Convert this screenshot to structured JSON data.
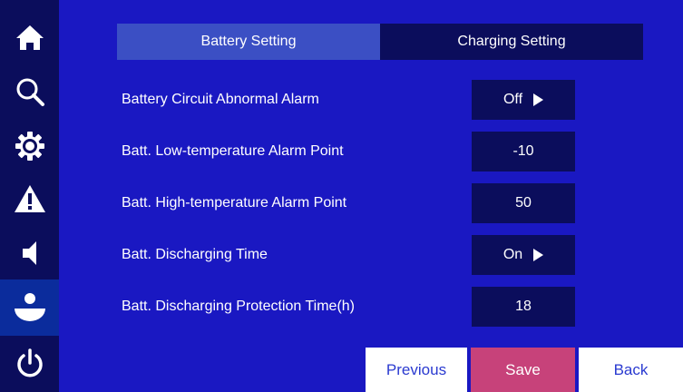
{
  "colors": {
    "background": "#1a18c2",
    "sidebar": "#0b0d5c",
    "sidebar_active": "#0b2c9c",
    "tab_active": "#3b4fc4",
    "value_box": "#0b0d5c",
    "save_button": "#c7427a",
    "secondary_button_text": "#2a3ad0"
  },
  "sidebar": {
    "items": [
      {
        "icon": "home-icon"
      },
      {
        "icon": "search-icon"
      },
      {
        "icon": "gear-icon"
      },
      {
        "icon": "warning-icon"
      },
      {
        "icon": "speaker-icon"
      },
      {
        "icon": "user-icon",
        "active": true
      },
      {
        "icon": "power-icon"
      }
    ]
  },
  "tabs": [
    {
      "label": "Battery Setting",
      "active": true
    },
    {
      "label": "Charging Setting",
      "active": false
    }
  ],
  "settings": [
    {
      "label": "Battery Circuit Abnormal Alarm",
      "value": "Off",
      "has_arrow": true
    },
    {
      "label": "Batt. Low-temperature Alarm Point",
      "value": "-10",
      "has_arrow": false
    },
    {
      "label": "Batt. High-temperature Alarm Point",
      "value": "50",
      "has_arrow": false
    },
    {
      "label": "Batt. Discharging Time",
      "value": "On",
      "has_arrow": true
    },
    {
      "label": "Batt. Discharging Protection Time(h)",
      "value": "18",
      "has_arrow": false
    }
  ],
  "buttons": {
    "previous": "Previous",
    "save": "Save",
    "back": "Back"
  }
}
